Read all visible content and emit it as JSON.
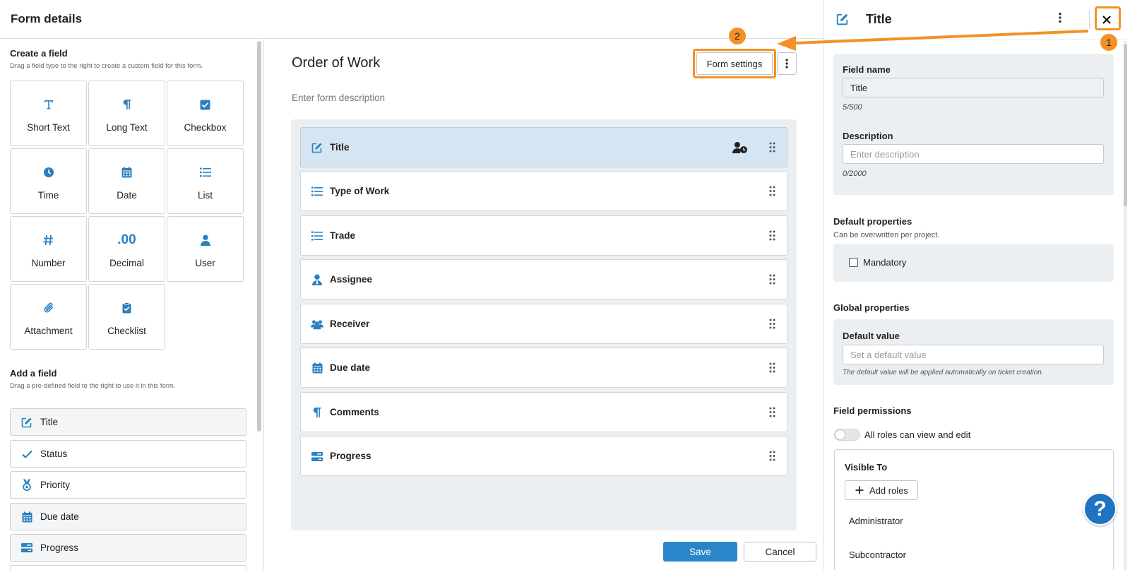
{
  "header": {
    "title": "Form details"
  },
  "create": {
    "heading": "Create a field",
    "sub": "Drag a field type to the right to create a custom field for this form.",
    "tiles": [
      {
        "label": "Short Text",
        "icon": "text-T-icon"
      },
      {
        "label": "Long Text",
        "icon": "paragraph-icon"
      },
      {
        "label": "Checkbox",
        "icon": "checkbox-icon"
      },
      {
        "label": "Time",
        "icon": "clock-icon"
      },
      {
        "label": "Date",
        "icon": "calendar-icon"
      },
      {
        "label": "List",
        "icon": "list-icon"
      },
      {
        "label": "Number",
        "icon": "hash-icon"
      },
      {
        "label": "Decimal",
        "icon": "decimal-icon",
        "glyph": ".00"
      },
      {
        "label": "User",
        "icon": "user-icon"
      },
      {
        "label": "Attachment",
        "icon": "paperclip-icon"
      },
      {
        "label": "Checklist",
        "icon": "clipboard-check-icon"
      }
    ]
  },
  "add": {
    "heading": "Add a field",
    "sub": "Drag a pre-defined field to the right to use it in this form.",
    "items": [
      {
        "label": "Title"
      },
      {
        "label": "Status"
      },
      {
        "label": "Priority"
      },
      {
        "label": "Due date"
      },
      {
        "label": "Progress"
      }
    ]
  },
  "form": {
    "title": "Order of Work",
    "description_placeholder": "Enter form description",
    "settings_label": "Form settings",
    "fields": [
      {
        "label": "Title"
      },
      {
        "label": "Type of Work"
      },
      {
        "label": "Trade"
      },
      {
        "label": "Assignee"
      },
      {
        "label": "Receiver"
      },
      {
        "label": "Due date"
      },
      {
        "label": "Comments"
      },
      {
        "label": "Progress"
      }
    ],
    "save_label": "Save",
    "cancel_label": "Cancel"
  },
  "panel": {
    "title": "Title",
    "field_name_label": "Field name",
    "field_name_value": "Title",
    "field_name_count": "5/500",
    "description_label": "Description",
    "description_placeholder": "Enter description",
    "description_count": "0/2000",
    "default_props_heading": "Default properties",
    "default_props_sub": "Can be overwritten per project.",
    "mandatory_label": "Mandatory",
    "global_props_heading": "Global properties",
    "default_value_label": "Default value",
    "default_value_placeholder": "Set a default value",
    "default_value_hint": "The default value will be applied automatically on ticket creation.",
    "permissions_heading": "Field permissions",
    "permissions_toggle_label": "All roles can view and edit",
    "visible_to_label": "Visible To",
    "add_roles_label": "Add roles",
    "roles": [
      "Administrator",
      "Subcontractor"
    ]
  },
  "annotations": {
    "badge1": "1",
    "badge2": "2"
  },
  "colors": {
    "accent": "#2a80c0",
    "highlight": "#f39224",
    "selected_row": "#d5e6f2",
    "save": "#2a86c9"
  }
}
